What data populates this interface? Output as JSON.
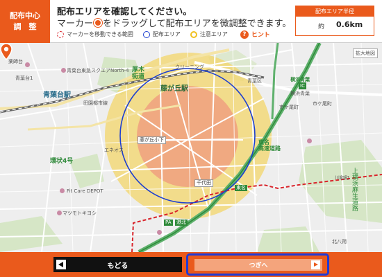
{
  "header": {
    "side_tab": {
      "line1": "配布中心",
      "line2": "調　整"
    },
    "title": "配布エリアを確認してください。",
    "instruction_pre": "マーカー",
    "instruction_post": "をドラッグして配布エリアを微調整できます。",
    "legend": {
      "movable": "マーカーを移動できる範囲",
      "area": "配布エリア",
      "caution": "注意エリア"
    },
    "hint": "ヒント",
    "radius": {
      "label": "配布エリア半径",
      "prefix": "約",
      "value": "0.6km"
    }
  },
  "map": {
    "station_main": "藤が丘駅",
    "station_aobadai": "青葉台駅",
    "area_atsugi": "厚木\n街道",
    "hw_tomei": "東名\n高速道路",
    "loop4": "環状4号",
    "ic_badge": "IC",
    "ic_name": "横浜青葉",
    "ic_exit": "横浜青葉",
    "eneos": "エネオス",
    "fujigaoka_shita": "藤が丘小下",
    "chiyoda": "千代田",
    "tomei_road": "東名",
    "minami_ichigao": "市ケ尾町",
    "ichigao": "市ケ尾町",
    "aoba_ward": "青葉区",
    "kawawa": "川和町",
    "yokohama_asahi": "上横浜麻生道路",
    "kitahachi": "北八朔",
    "yakushi": "薬師台",
    "cleaning": "クリーニング",
    "fit_care": "Fit Care DEPOT",
    "matsumoto": "マツモトキヨシ",
    "north_aoba": "青葉台東急スクエアNorth-4",
    "aobadai1": "青葉台1",
    "rail_denentoshi": "田園都市線",
    "badge_tomei": "東名",
    "badge_pa": "PA",
    "badge_kohoku": "港北",
    "zoom": "拡大地図"
  },
  "footer": {
    "back": "もどる",
    "next": "つぎへ"
  },
  "colors": {
    "accent": "#ea5a1c",
    "area_ring": "#1d3fd0",
    "caution": "#f3d56a",
    "movable": "#f0a07f",
    "focus_outline": "#1f3ad6"
  }
}
